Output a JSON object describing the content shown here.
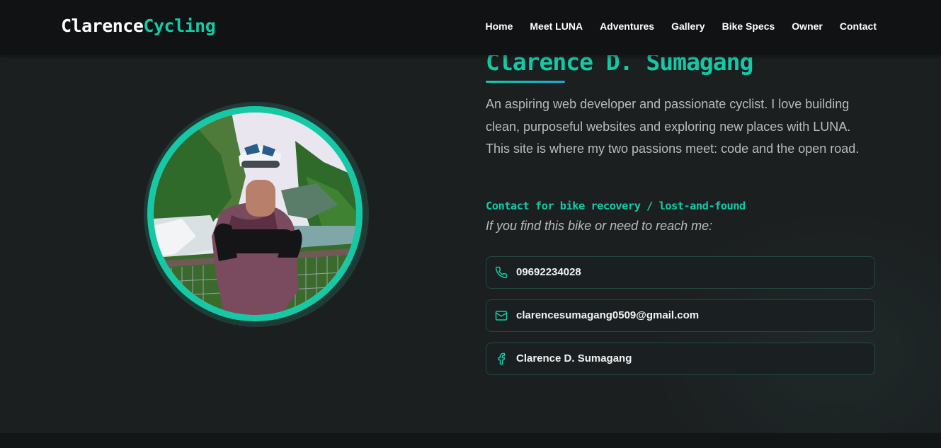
{
  "brand": {
    "part1": "Clarence",
    "part2": "Cycling"
  },
  "nav": {
    "items": [
      {
        "label": "Home"
      },
      {
        "label": "Meet LUNA"
      },
      {
        "label": "Adventures"
      },
      {
        "label": "Gallery"
      },
      {
        "label": "Bike Specs"
      },
      {
        "label": "Owner"
      },
      {
        "label": "Contact"
      }
    ]
  },
  "owner": {
    "name": "Clarence D. Sumagang",
    "bio": "An aspiring web developer and passionate cyclist. I love building clean, purposeful websites and exploring new places with LUNA. This site is where my two passions meet: code and the open road.",
    "contact_heading": "Contact for bike recovery / lost-and-found",
    "contact_sub": "If you find this bike or need to reach me:",
    "contacts": [
      {
        "icon": "phone-icon",
        "value": "09692234028"
      },
      {
        "icon": "mail-icon",
        "value": "clarencesumagang0509@gmail.com"
      },
      {
        "icon": "facebook-icon",
        "value": "Clarence D. Sumagang"
      }
    ]
  },
  "colors": {
    "accent": "#16c9a6",
    "background": "#1b1f20",
    "navbar": "#101213"
  }
}
